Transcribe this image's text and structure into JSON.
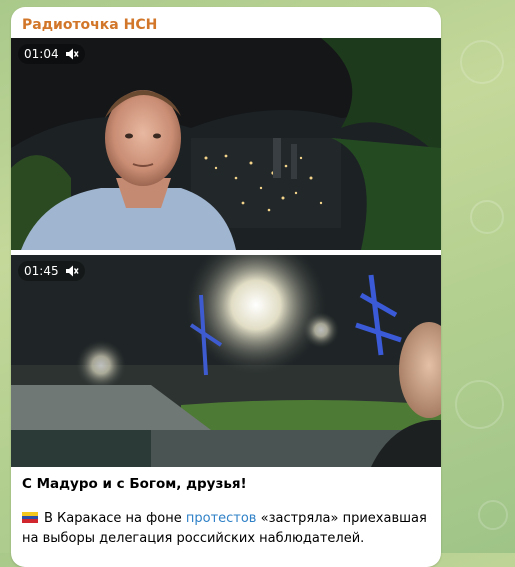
{
  "message": {
    "channel_name": "Радиоточка НСН",
    "videos": [
      {
        "time": "01:04",
        "icon": "muted-speaker-icon"
      },
      {
        "time": "01:45",
        "icon": "muted-speaker-icon"
      }
    ],
    "title": "С Мадуро и с Богом, друзья!",
    "flag_icon": "venezuela-flag-icon",
    "body_before": "В Каракасе на фоне ",
    "body_link": "протестов",
    "body_after": " «застряла» приехавшая на выборы делегация российских наблюдателей."
  },
  "colors": {
    "channel": "#d2762a",
    "link": "#2f81c7",
    "chat_background": "#b2cf8f"
  }
}
